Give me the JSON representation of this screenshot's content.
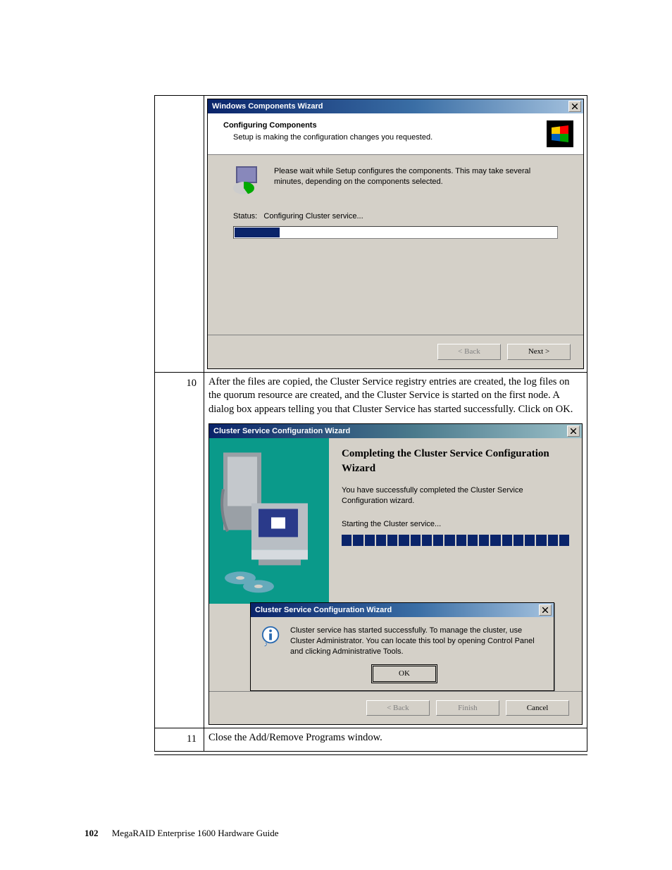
{
  "row9": {
    "wiz_title": "Windows Components Wizard",
    "head_bold": "Configuring Components",
    "head_sub": "Setup is making the configuration changes you requested.",
    "wait_text": "Please wait while Setup configures the components. This may take several minutes, depending on the components selected.",
    "status_label": "Status:",
    "status_value": "Configuring Cluster service...",
    "back": "< Back",
    "next": "Next >"
  },
  "row10": {
    "step": "10",
    "instruction": "After the files are copied, the Cluster Service registry entries are created, the log files on the quorum resource are created, and the Cluster Service is started on the first node. A dialog box appears telling you that Cluster Service has started successfully. Click on OK.",
    "wiz_title": "Cluster Service Configuration Wizard",
    "heading": "Completing the Cluster Service Configuration Wizard",
    "done_text": "You have successfully completed the Cluster Service Configuration wizard.",
    "starting_text": "Starting the Cluster service...",
    "popup_title": "Cluster Service Configuration Wizard",
    "popup_msg": "Cluster service has started successfully. To manage the cluster, use Cluster Administrator. You can locate this tool by opening Control Panel and clicking Administrative Tools.",
    "ok": "OK",
    "back": "< Back",
    "finish": "Finish",
    "cancel": "Cancel"
  },
  "row11": {
    "step": "11",
    "instruction": "Close the Add/Remove Programs window."
  },
  "footer": {
    "page": "102",
    "title": "MegaRAID Enterprise 1600 Hardware Guide"
  }
}
